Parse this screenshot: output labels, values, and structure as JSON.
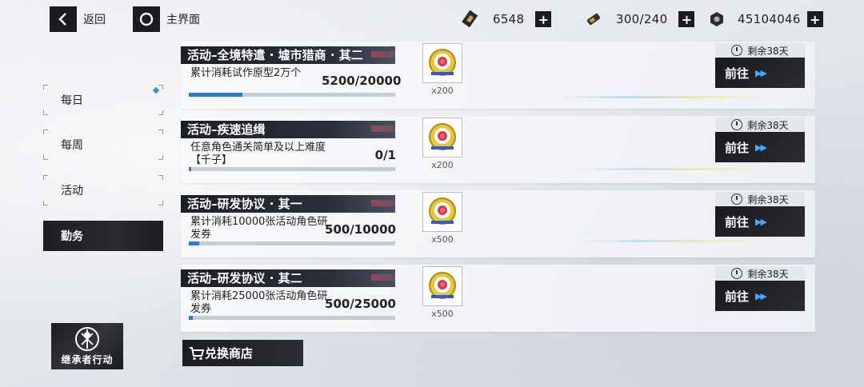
{
  "topbar": {
    "back_label": "返回",
    "home_label": "主界面"
  },
  "resources": [
    {
      "icon": "ticket-icon",
      "value": "6548"
    },
    {
      "icon": "battery-icon",
      "value": "300/240"
    },
    {
      "icon": "nut-icon",
      "value": "45104046"
    }
  ],
  "sidebar": {
    "items": [
      {
        "label": "每日"
      },
      {
        "label": "每周"
      },
      {
        "label": "活动"
      },
      {
        "label": "勤务"
      }
    ],
    "active_index": 3
  },
  "tasks": [
    {
      "title": "活动–全境特遣 · 墟市猎商 · 其二",
      "desc": "累计消耗试作原型2万个",
      "progress": "5200/20000",
      "progress_ratio": 0.26,
      "reward_count": "x200",
      "remaining": "剩余38天",
      "goto": "前往"
    },
    {
      "title": "活动–疾速追缉",
      "desc": "任意角色通关简单及以上难度【千子】",
      "progress": "0/1",
      "progress_ratio": 0.0,
      "reward_count": "x200",
      "remaining": "剩余38天",
      "goto": "前往"
    },
    {
      "title": "活动–研发协议 · 其一",
      "desc": "累计消耗10000张活动角色研发券",
      "progress": "500/10000",
      "progress_ratio": 0.05,
      "reward_count": "x500",
      "remaining": "剩余38天",
      "goto": "前往"
    },
    {
      "title": "活动–研发协议 · 其二",
      "desc": "累计消耗25000张活动角色研发券",
      "progress": "500/25000",
      "progress_ratio": 0.02,
      "reward_count": "x500",
      "remaining": "剩余38天",
      "goto": "前往"
    }
  ],
  "shop_label": "兑换商店",
  "logo_text": "继承者行动",
  "colors": {
    "accent_blue": "#2e7ad1",
    "dark_panel": "#1c1d22",
    "arrow_blue": "#4aa6ff"
  }
}
